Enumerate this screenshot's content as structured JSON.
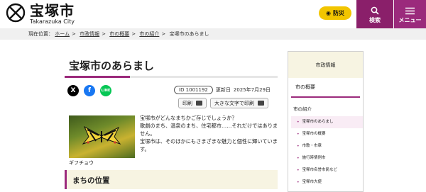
{
  "header": {
    "logo_jp": "宝塚市",
    "logo_en": "Takarazuka City",
    "bousai_label": "防災",
    "search_label": "検索",
    "menu_label": "メニュー",
    "accent_color": "#9b2a7c"
  },
  "breadcrumb": {
    "prefix": "現在位置：",
    "items": [
      "ホーム",
      "市政情報",
      "市の概要",
      "市の紹介",
      "宝塚市のあらまし"
    ]
  },
  "main": {
    "title": "宝塚市のあらまし",
    "social": {
      "x": "X",
      "facebook": "f",
      "line": "LINE"
    },
    "id_label": "ID 1001192",
    "updated_label": "更新日",
    "updated_date": "2025年7月29日",
    "print_label": "印刷",
    "print_large_label": "大きな文字で印刷",
    "photo_caption": "ギフチョウ",
    "intro_lines": [
      "宝塚市がどんなまちかご存じでしょうか？",
      "歌劇のまち、温泉のまち、住宅都市……それだけではありません。",
      "宝塚市は、そのほかにもさまざまな魅力と個性に輝いています。"
    ],
    "section_heading": "まちの位置"
  },
  "sidebar": {
    "heading": "市政情報",
    "category": "市の概要",
    "subcategory": "市の紹介",
    "items": [
      {
        "label": "宝塚市のあらまし",
        "active": true
      },
      {
        "label": "宝塚市の概要",
        "active": false
      },
      {
        "label": "市歌・市章",
        "active": false
      },
      {
        "label": "施行時情例市",
        "active": false
      },
      {
        "label": "宝塚市名誉市民など",
        "active": false
      },
      {
        "label": "宝塚市大使",
        "active": false
      }
    ]
  }
}
